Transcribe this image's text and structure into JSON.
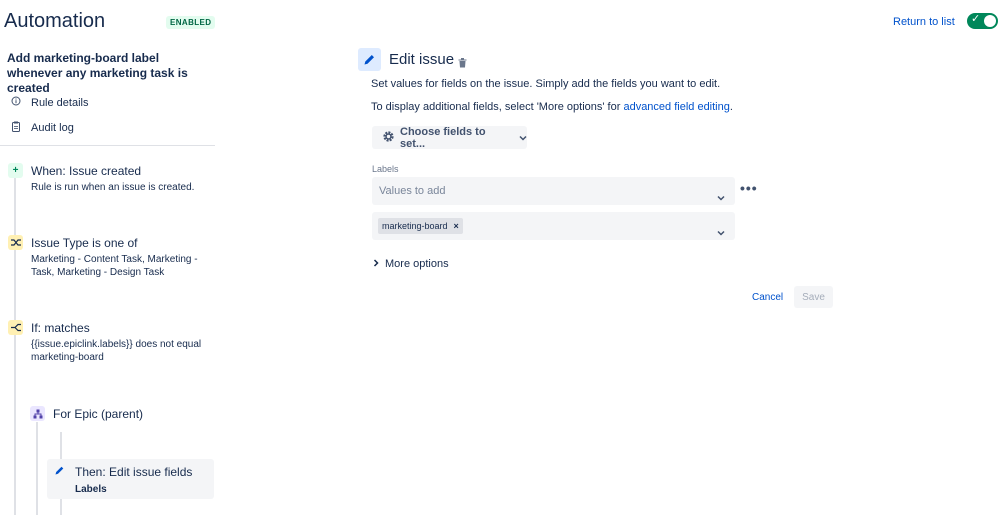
{
  "header": {
    "title": "Automation",
    "status_badge": "ENABLED",
    "return_link": "Return to list",
    "toggle_check": "✓"
  },
  "sidebar": {
    "rule_name": "Add marketing-board label whenever any marketing task is created",
    "nav": [
      {
        "label": "Rule details",
        "icon": "info-icon"
      },
      {
        "label": "Audit log",
        "icon": "clipboard-icon"
      }
    ],
    "components": [
      {
        "title": "When: Issue created",
        "description": "Rule is run when an issue is created.",
        "icon": "plus-icon",
        "icon_color": "#00875a",
        "icon_bg": "#e3fcef"
      },
      {
        "title": "Issue Type is one of",
        "description": "Marketing - Content Task, Marketing - Task, Marketing - Design Task",
        "icon": "shuffle-icon",
        "icon_color": "#172b4d",
        "icon_bg": "#fff0b3"
      },
      {
        "title": "If: matches",
        "description": "{{issue.epiclink.labels}} does not equal marketing-board",
        "icon": "branch-icon",
        "icon_color": "#172b4d",
        "icon_bg": "#fff0b3"
      },
      {
        "title": "For Epic (parent)",
        "description": "",
        "icon": "hierarchy-icon",
        "icon_color": "#5243aa",
        "icon_bg": "#eae6ff"
      },
      {
        "title": "Then: Edit issue fields",
        "description": "Labels",
        "icon": "pencil-icon",
        "icon_color": "#0052cc",
        "icon_bg": ""
      }
    ]
  },
  "panel": {
    "title": "Edit issue",
    "help_line1": "Set values for fields on the issue. Simply add the fields you want to edit.",
    "help_line2_prefix": "To display additional fields, select 'More options' for ",
    "help_line2_link": "advanced field editing",
    "help_line2_suffix": ".",
    "choose_fields": "Choose fields to set...",
    "field_label": "Labels",
    "values_placeholder": "Values to add",
    "more_dots": "•••",
    "tags": [
      "marketing-board"
    ],
    "tag_remove": "×",
    "more_options": "More options",
    "cancel": "Cancel",
    "save": "Save"
  },
  "colors": {
    "accent": "#0052cc",
    "enabled": "#00875a"
  }
}
